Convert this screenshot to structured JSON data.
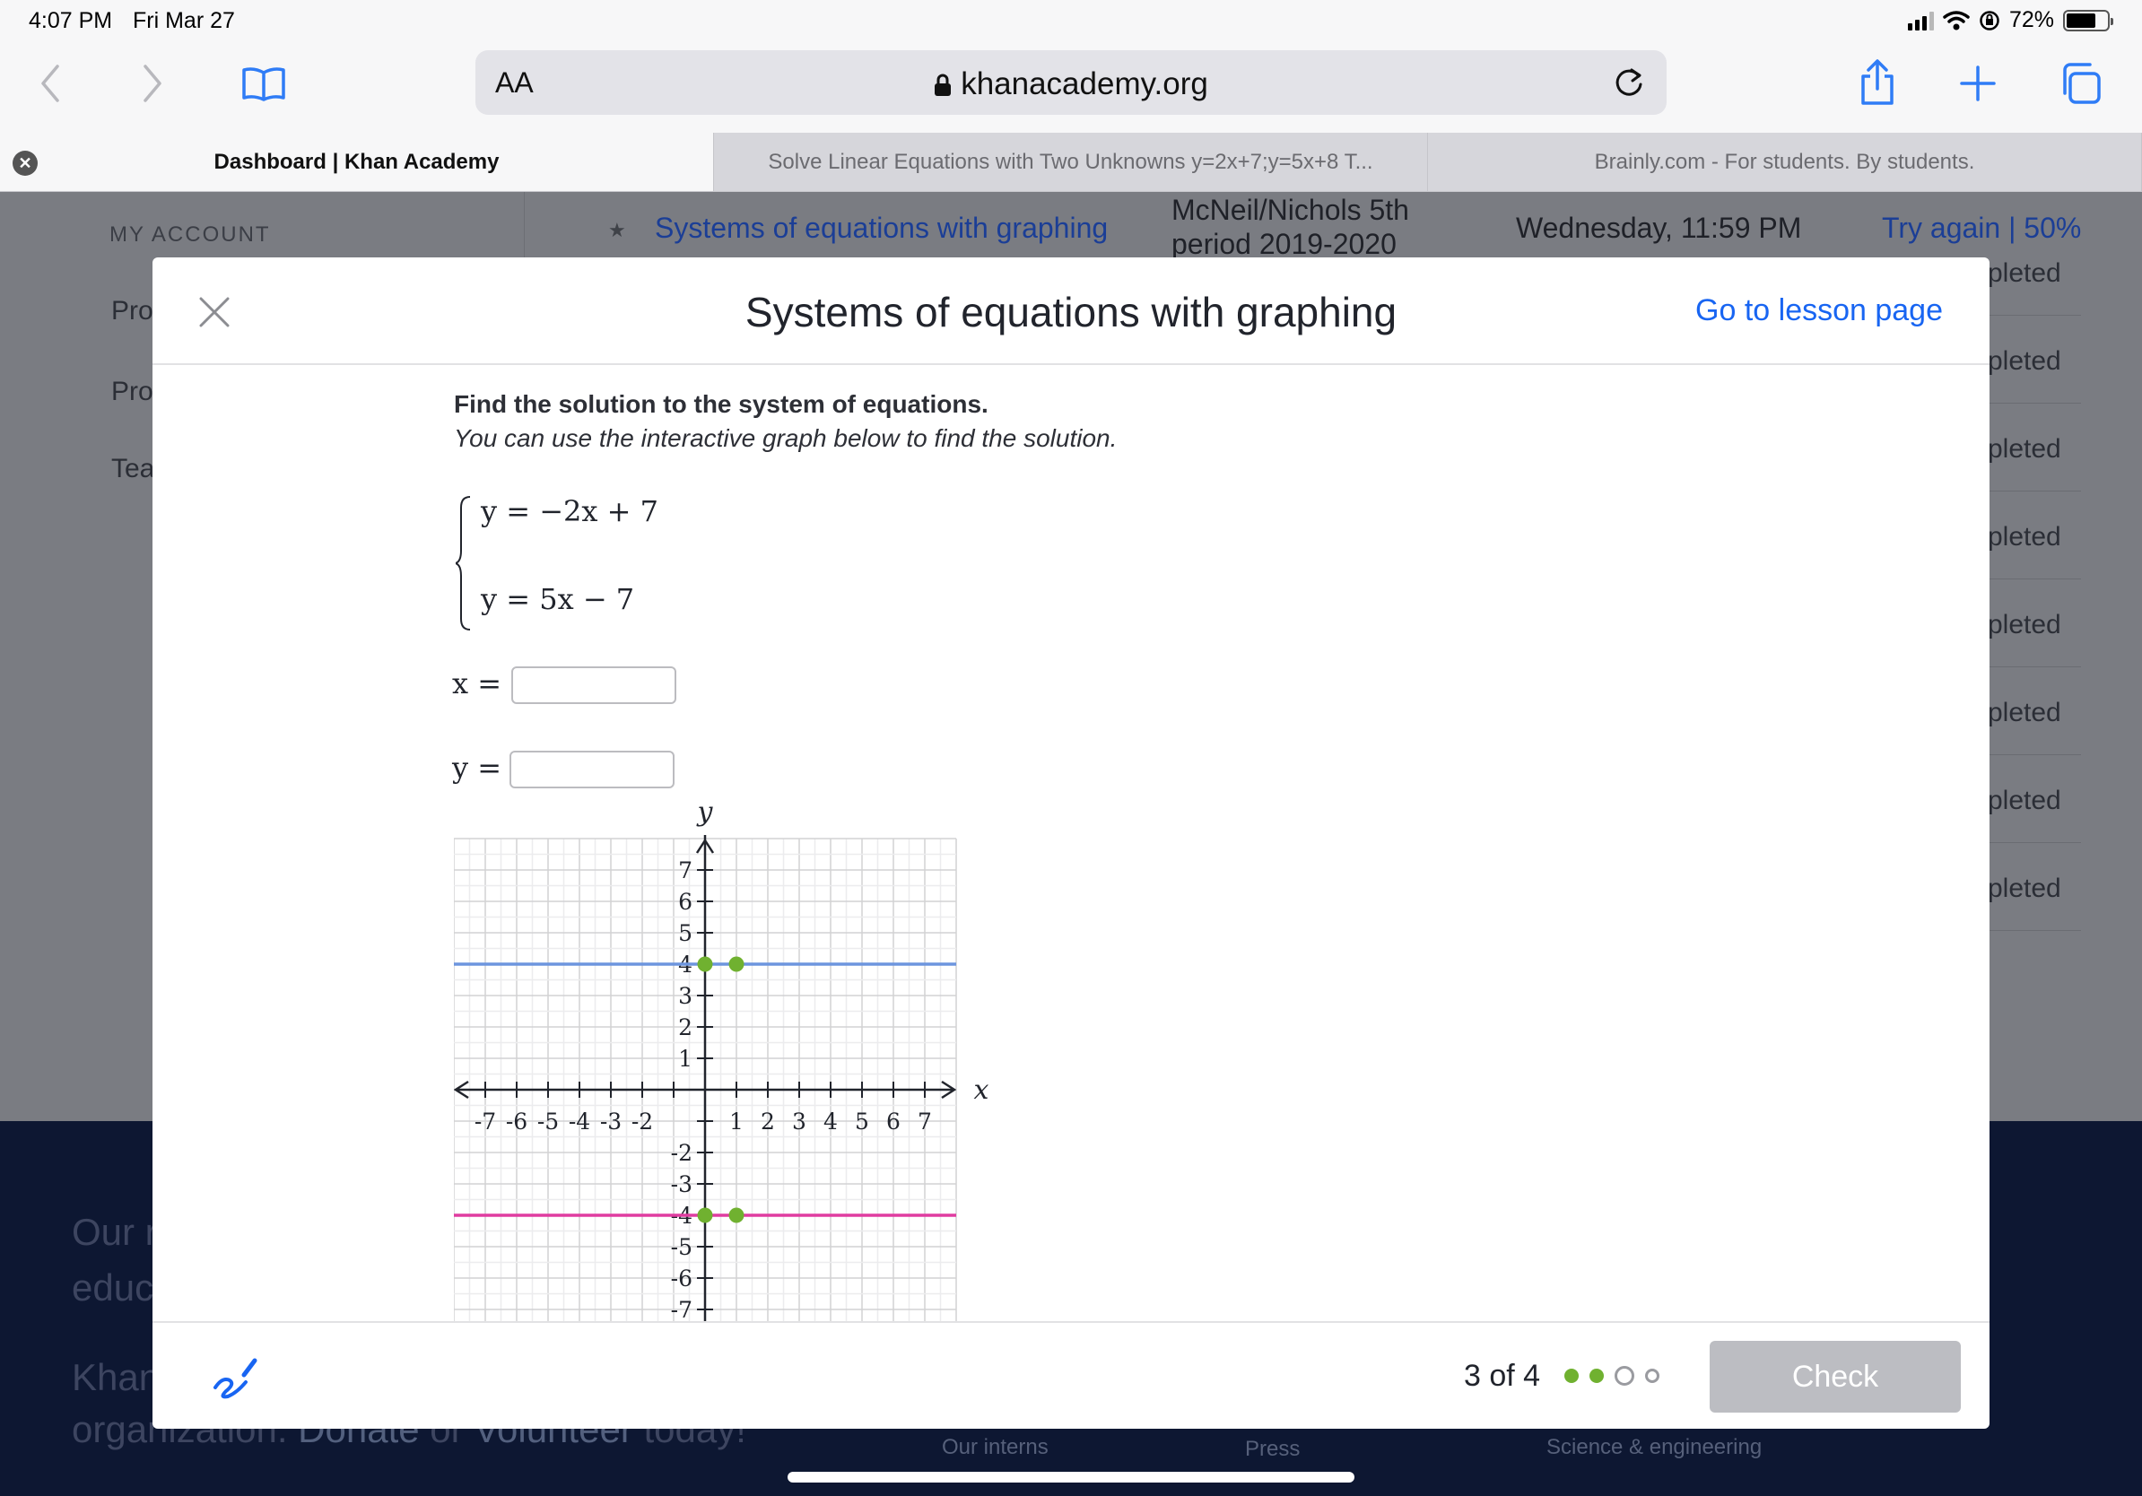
{
  "status_bar": {
    "time": "4:07 PM",
    "date": "Fri Mar 27",
    "battery": "72%",
    "battery_level": 0.72
  },
  "browser": {
    "url": "khanacademy.org",
    "text_size_label": "AA",
    "tabs": [
      {
        "title": "Dashboard | Khan Academy",
        "active": true
      },
      {
        "title": "Solve Linear Equations with Two Unknowns y=2x+7;y=5x+8 T...",
        "active": false
      },
      {
        "title": "Brainly.com - For students. By students.",
        "active": false
      }
    ]
  },
  "background_page": {
    "sidebar_heading": "MY ACCOUNT",
    "sidebar_items": [
      "Pro",
      "Pro",
      "Tea"
    ],
    "assignment": {
      "title": "Systems of equations with graphing",
      "class_line1": "McNeil/Nichols 5th",
      "class_line2": "period 2019-2020",
      "due": "Wednesday, 11:59 PM",
      "action": "Try again",
      "separator": "|",
      "score": "50%"
    },
    "status_fragment": "pleted",
    "footer": {
      "line1": "Our r",
      "line2": "educ",
      "line3": "Khan",
      "line4_a": "organization.",
      "line4_b": "Donate",
      "line4_c": "or",
      "line4_d": "Volunteer",
      "line4_e": "today!",
      "links": [
        "Our interns",
        "Press",
        "Science & engineering"
      ]
    }
  },
  "modal": {
    "title": "Systems of equations with graphing",
    "lesson_link": "Go to lesson page",
    "prompt": "Find the solution to the system of equations.",
    "hint": "You can use the interactive graph below to find the solution.",
    "equations": [
      "y = −2x + 7",
      "y = 5x − 7"
    ],
    "x_label": "x =",
    "y_label": "y =",
    "x_value": "",
    "y_value": "",
    "progress": "3 of 4",
    "check_label": "Check"
  },
  "chart_data": {
    "type": "line",
    "xlabel": "x",
    "ylabel": "y",
    "xlim": [
      -8,
      8
    ],
    "ylim": [
      -8,
      8
    ],
    "grid": true,
    "x_ticks": [
      "-7",
      "-6",
      "-5",
      "-4",
      "-3",
      "-2",
      "1",
      "2",
      "3",
      "4",
      "5",
      "6",
      "7"
    ],
    "y_ticks": [
      "7",
      "6",
      "5",
      "4",
      "3",
      "2",
      "1",
      "-2",
      "-3",
      "-4",
      "-5",
      "-6",
      "-7"
    ],
    "series": [
      {
        "color": "#6d95de",
        "points": [
          [
            0,
            4
          ],
          [
            1,
            4
          ]
        ]
      },
      {
        "color": "#e03ca0",
        "points": [
          [
            0,
            -4
          ],
          [
            1,
            -4
          ]
        ]
      }
    ],
    "point_color": "#70b130"
  }
}
